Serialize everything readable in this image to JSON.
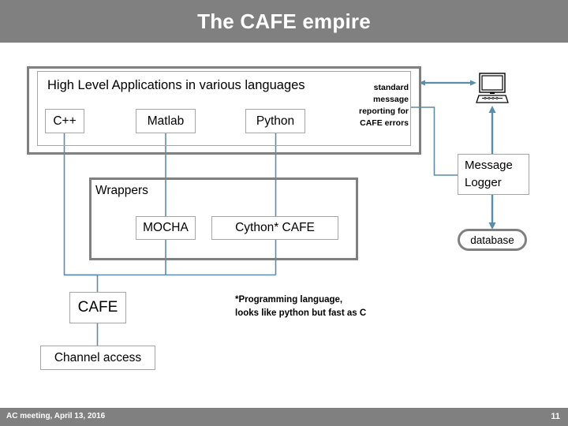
{
  "slide": {
    "title": "The CAFE empire",
    "footer_left": "AC meeting, April 13, 2016",
    "footer_page": "11"
  },
  "colors": {
    "title_bar": "#808080",
    "footer_bar": "#808080",
    "thick_border": "#808080",
    "thin_border": "#a6a6a6",
    "connector": "#5b8ca8",
    "title_text": "#ffffff"
  },
  "diagram": {
    "applications": {
      "heading": "High Level Applications in various languages",
      "languages": [
        {
          "label": "C++"
        },
        {
          "label": "Matlab"
        },
        {
          "label": "Python"
        }
      ],
      "note": "standard message reporting for CAFE errors"
    },
    "wrappers": {
      "label": "Wrappers",
      "items": [
        {
          "label": "MOCHA"
        },
        {
          "label": "Cython* CAFE"
        }
      ]
    },
    "core": {
      "cafe_label": "CAFE",
      "channel_access_label": "Channel access",
      "footnote_line1": "*Programming language,",
      "footnote_line2": "looks like python but fast as C"
    },
    "logging": {
      "computer_icon": "desktop-computer-icon",
      "message_logger_line1": "Message",
      "message_logger_line2": "Logger",
      "database_label": "database"
    }
  }
}
